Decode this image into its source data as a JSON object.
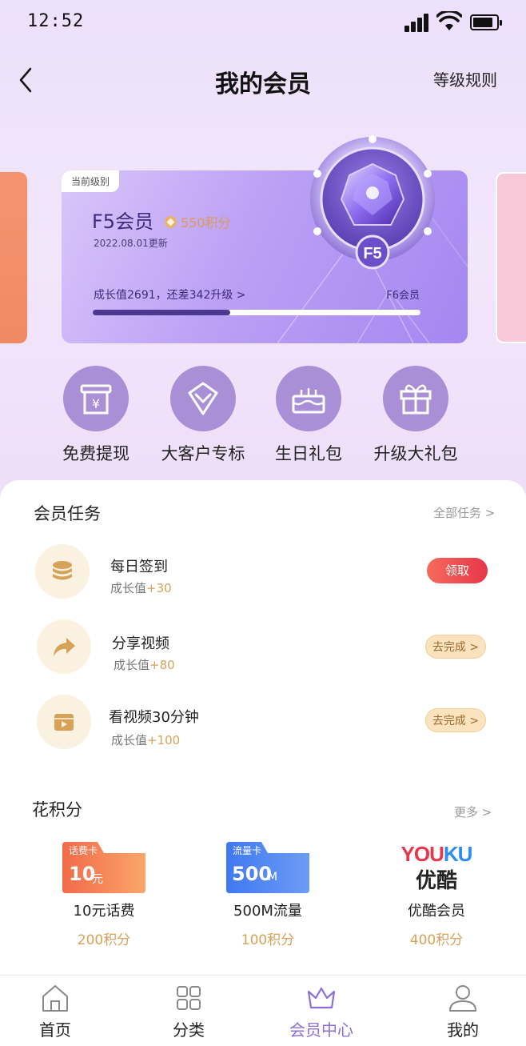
{
  "status_bar": {
    "time": "12:52"
  },
  "header": {
    "title": "我的会员",
    "rules_label": "等级规则"
  },
  "member_card": {
    "tag": "当前级别",
    "level_name": "F5会员",
    "points": "550积分",
    "update_date": "2022.08.01更新",
    "growth_text": "成长值2691，还差342升级  >",
    "next_level": "F6会员",
    "progress_fraction": 0.42,
    "badge_label": "F5"
  },
  "benefits": [
    {
      "label": "免费提现",
      "icon": "yen-receipt-icon"
    },
    {
      "label": "大客户专标",
      "icon": "diamond-badge-icon"
    },
    {
      "label": "生日礼包",
      "icon": "birthday-cake-icon"
    },
    {
      "label": "升级大礼包",
      "icon": "gift-box-icon"
    }
  ],
  "tasks_section": {
    "title": "会员任务",
    "more": "全部任务  >",
    "items": [
      {
        "name": "每日签到",
        "reward_prefix": "成长值",
        "reward_value": "+30",
        "action": "领取",
        "icon": "coin-stack-icon"
      },
      {
        "name": "分享视频",
        "reward_prefix": "成长值",
        "reward_value": "+80",
        "action": "去完成 >",
        "icon": "share-arrow-icon"
      },
      {
        "name": "看视频30分钟",
        "reward_prefix": "成长值",
        "reward_value": "+100",
        "action": "去完成 >",
        "icon": "video-play-icon"
      }
    ]
  },
  "points_section": {
    "title": "花积分",
    "more": "更多  >",
    "items": [
      {
        "card_tag": "话费卡",
        "card_value": "10",
        "card_unit": "元",
        "name": "10元话费",
        "cost": "200积分"
      },
      {
        "card_tag": "流量卡",
        "card_value": "500",
        "card_unit": "M",
        "name": "500M流量",
        "cost": "100积分"
      },
      {
        "logo_text": "YOUKU",
        "logo_sub": "优酷",
        "name": "优酷会员",
        "cost": "400积分"
      }
    ]
  },
  "tab_bar": [
    {
      "label": "首页",
      "icon": "home-icon",
      "active": false
    },
    {
      "label": "分类",
      "icon": "category-grid-icon",
      "active": false
    },
    {
      "label": "会员中心",
      "icon": "crown-icon",
      "active": true
    },
    {
      "label": "我的",
      "icon": "user-icon",
      "active": false
    }
  ],
  "colors": {
    "accent": "#8b6fd6",
    "gold": "#d6a258",
    "claim_red": "#e8364a"
  }
}
